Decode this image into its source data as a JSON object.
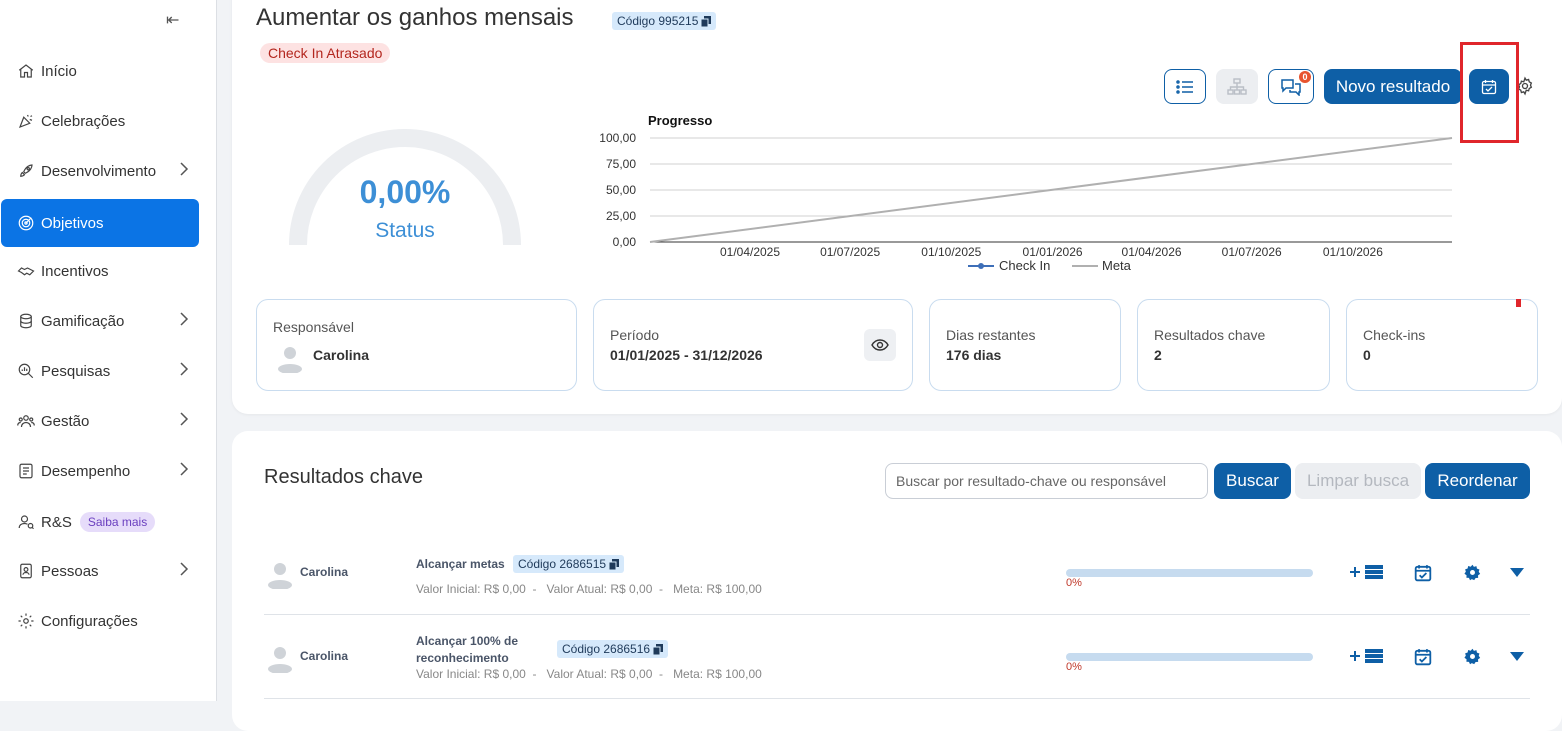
{
  "sidebar": {
    "items": [
      {
        "label": "Início",
        "icon": "home-icon"
      },
      {
        "label": "Celebrações",
        "icon": "party-icon"
      },
      {
        "label": "Desenvolvimento",
        "icon": "rocket-icon",
        "chevron": true
      },
      {
        "label": "Objetivos",
        "icon": "target-icon",
        "active": true
      },
      {
        "label": "Incentivos",
        "icon": "handshake-icon"
      },
      {
        "label": "Gamificação",
        "icon": "coins-icon",
        "chevron": true
      },
      {
        "label": "Pesquisas",
        "icon": "search-chart-icon",
        "chevron": true
      },
      {
        "label": "Gestão",
        "icon": "people-icon",
        "chevron": true
      },
      {
        "label": "Desempenho",
        "icon": "checklist-icon",
        "chevron": true
      },
      {
        "label": "R&S",
        "icon": "user-search-icon",
        "badge": "Saiba mais"
      },
      {
        "label": "Pessoas",
        "icon": "badge-icon",
        "chevron": true
      },
      {
        "label": "Configurações",
        "icon": "gear-icon"
      }
    ]
  },
  "objective": {
    "title": "Aumentar os ganhos mensais",
    "code": "Código 995215",
    "status_badge": "Check In Atrasado",
    "gauge_value": "0,00%",
    "gauge_label": "Status",
    "progress_fraction": 0
  },
  "toolbar": {
    "new_result_label": "Novo resultado",
    "chat_count": "0"
  },
  "chart_data": {
    "type": "line",
    "title": "Progresso",
    "x": [
      "01/01/2025",
      "01/04/2025",
      "01/07/2025",
      "01/10/2025",
      "01/01/2026",
      "01/04/2026",
      "01/07/2026",
      "01/10/2026",
      "31/12/2026"
    ],
    "x_tick_labels": [
      "01/04/2025",
      "01/07/2025",
      "01/10/2025",
      "01/01/2026",
      "01/04/2026",
      "01/07/2026",
      "01/10/2026"
    ],
    "y_tick_labels": [
      "100,00",
      "75,00",
      "50,00",
      "25,00",
      "0,00"
    ],
    "ylim": [
      0,
      100
    ],
    "series": [
      {
        "name": "Check In",
        "color": "#3e6fb8",
        "values": []
      },
      {
        "name": "Meta",
        "color": "#b0b0b0",
        "points": [
          [
            "01/01/2025",
            0
          ],
          [
            "31/12/2026",
            100
          ]
        ]
      }
    ],
    "legend_position": "bottom",
    "grid": true
  },
  "info": {
    "responsavel_label": "Responsável",
    "responsavel_value": "Carolina",
    "periodo_label": "Período",
    "periodo_value": "01/01/2025 - 31/12/2026",
    "dias_label": "Dias restantes",
    "dias_value": "176 dias",
    "resultados_label": "Resultados chave",
    "resultados_value": "2",
    "checkins_label": "Check-ins",
    "checkins_value": "0"
  },
  "key_results": {
    "title": "Resultados chave",
    "search_placeholder": "Buscar por resultado-chave ou responsável",
    "search_button": "Buscar",
    "clear_button": "Limpar busca",
    "reorder_button": "Reordenar",
    "rows": [
      {
        "owner": "Carolina",
        "name": "Alcançar metas",
        "code": "Código 2686515",
        "valor_inicial": "Valor Inicial: R$ 0,00",
        "valor_atual": "Valor Atual: R$ 0,00",
        "meta": "Meta: R$ 100,00",
        "progress": "0%"
      },
      {
        "owner": "Carolina",
        "name_line1": "Alcançar 100% de",
        "name_line2": "reconhecimento",
        "code": "Código 2686516",
        "valor_inicial": "Valor Inicial: R$ 0,00",
        "valor_atual": "Valor Atual: R$ 0,00",
        "meta": "Meta: R$ 100,00",
        "progress": "0%"
      }
    ]
  }
}
